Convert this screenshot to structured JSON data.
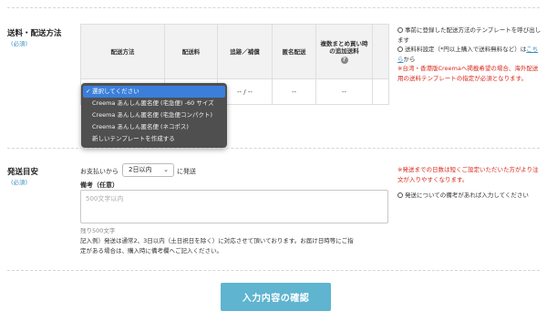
{
  "shipping": {
    "title": "送料・配送方法",
    "required": "(必須)",
    "table_headers": [
      "配送方法",
      "配送料",
      "追跡／補償",
      "匿名配送",
      "複数まとめ買い時の追加送料"
    ],
    "row_values": [
      "",
      "",
      "-- / --",
      "--",
      "--"
    ],
    "notes": {
      "note1": "事前に登録した配送方法のテンプレートを呼び出します",
      "note2_prefix": "送料料設定（*円以上購入で送料無料など）は",
      "note2_link": "こちら",
      "note2_suffix": "から",
      "warning": "※台湾・香港版Creemaへ掲載希望の場合、海外配送用の送料テンプレートの指定が必須となります。"
    },
    "dropdown": {
      "options": [
        "選択してください",
        "Creema あんしん匿名便 (宅急便) -60 サイズ",
        "Creema あんしん匿名便 (宅急便コンパクト)",
        "Creema あんしん匿名便 (ネコポス)",
        "新しいテンプレートを作成する"
      ],
      "selected_index": 0
    }
  },
  "delivery": {
    "title": "発送目安",
    "required": "(必須)",
    "prefix": "お支払いから",
    "selected": "2日以内",
    "suffix": "に発送",
    "remark_label": "備考（任意）",
    "remark_placeholder": "500文字以内",
    "remaining": "残り500文字",
    "example_line1": "記入例）発送は通常2、3日以内（土日祝日を除く）に対応させて頂いております。お届け日時等にご指",
    "example_line2": "定がある場合は、購入時に備考欄へご記入ください。",
    "note_warning": "※発送までの日数は短くご設定いただいた方がより注文が入りやすくなります。",
    "note_remark": "発送についての備考があれば入力してください"
  },
  "confirm_button": "入力内容の確認",
  "colors": {
    "accent": "#5fb4d0",
    "link": "#3a8fc2",
    "warning": "#d9281c",
    "dropdown_highlight": "#3b7fdb"
  },
  "icons": {
    "help": "question-circle-icon",
    "checkmark": "check-icon",
    "select_chevron": "chevron-down-icon"
  }
}
